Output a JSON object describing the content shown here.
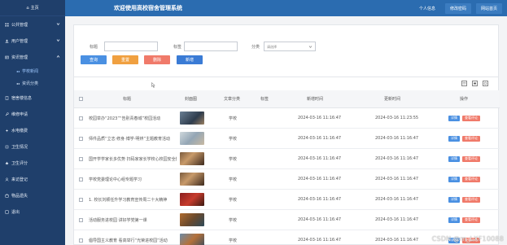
{
  "sidebar": {
    "home": "主页",
    "items": [
      {
        "label": "公共管理",
        "icon": "grid-icon",
        "expanded": false
      },
      {
        "label": "用户管理",
        "icon": "user-icon",
        "expanded": false
      },
      {
        "label": "资讯管理",
        "icon": "news-icon",
        "expanded": true
      }
    ],
    "subitems": [
      {
        "label": "学校新闻",
        "active": true
      },
      {
        "label": "资讯分类",
        "active": false
      }
    ],
    "items2": [
      {
        "label": "宿舍楼信息",
        "icon": "building-icon"
      },
      {
        "label": "维修申请",
        "icon": "wrench-icon"
      },
      {
        "label": "水电缴费",
        "icon": "bolt-icon"
      },
      {
        "label": "卫生情况",
        "icon": "clean-icon"
      },
      {
        "label": "卫生评分",
        "icon": "star-icon"
      },
      {
        "label": "来访登记",
        "icon": "visitor-icon"
      },
      {
        "label": "物品遗失",
        "icon": "box-icon"
      },
      {
        "label": "退出",
        "icon": "logout-icon"
      }
    ]
  },
  "topbar": {
    "title": "欢迎使用高校宿舍管理系统",
    "links": [
      "个人信息",
      "修改密码",
      "网站首页"
    ]
  },
  "search": {
    "title_label": "标题",
    "tag_label": "标签",
    "category_label": "分类",
    "category_placeholder": "请选择",
    "buttons": [
      "查询",
      "重置",
      "删除",
      "新增"
    ]
  },
  "table": {
    "headers": [
      "标题",
      "封面图",
      "文章分类",
      "标签",
      "新增时间",
      "更新时间",
      "操作"
    ],
    "rows": [
      {
        "title": "校园举办“2023”“告别青春城”校园活动",
        "category": "学校",
        "tag": "",
        "created": "2024-03-16 11:16:47",
        "updated": "2024-03-16 11:23:55"
      },
      {
        "title": "师件品质“立志·修身·博学·明辨”主题教育活动",
        "category": "学校",
        "tag": "",
        "created": "2024-03-16 11:16:47",
        "updated": "2024-03-16 11:16:47"
      },
      {
        "title": "国开学学家长多优势 扫码家家长学校心校园安全教育",
        "category": "学校",
        "tag": "",
        "created": "2024-03-16 11:16:47",
        "updated": "2024-03-16 11:16:47"
      },
      {
        "title": "学校党委理论中心组专题学习",
        "category": "学校",
        "tag": "",
        "created": "2024-03-16 11:16:47",
        "updated": "2024-03-16 11:16:47"
      },
      {
        "title": "1. 校长刘颖任升学习教育宣传周二十大精神",
        "category": "学校",
        "tag": "",
        "created": "2024-03-16 11:16:47",
        "updated": "2024-03-16 11:16:47"
      },
      {
        "title": "活动服务进校园 讲好学党第一课",
        "category": "学校",
        "tag": "",
        "created": "2024-03-16 11:16:47",
        "updated": "2024-03-16 11:16:47"
      },
      {
        "title": "倡导国主义教育 看高举行“光荣进校园”活动",
        "category": "学校",
        "tag": "",
        "created": "2024-03-16 11:16:47",
        "updated": "2024-03-16 11:16:47"
      }
    ],
    "action_labels": {
      "detail": "详情",
      "reply": "查看评论"
    }
  },
  "watermark": "CSDN @m_LXF10088",
  "colors": {
    "sidebar": "#1f3f6b",
    "topbar": "#2b6cb0",
    "query": "#4a90e2",
    "reset": "#f0a040",
    "delete": "#f07a6a",
    "add": "#3a7bd5"
  }
}
